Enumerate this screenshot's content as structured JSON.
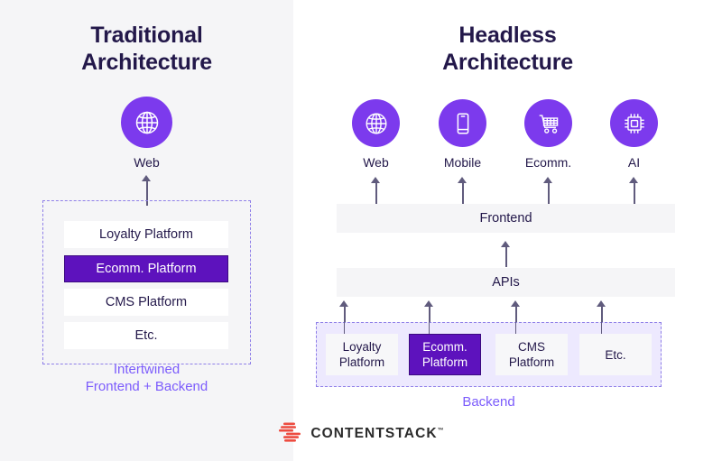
{
  "theme": {
    "page_bg": "#ffffff",
    "left_panel_bg": "#f5f5f7",
    "accent_purple": "#7c3aed",
    "deep_purple": "#5d12bd",
    "caption_purple": "#7c5cfc",
    "dash_purple": "#8f7fe8",
    "backend_fill": "#ede9fe",
    "text_dark": "#23184a",
    "arrow_gray": "#605b7d",
    "logo_red": "#ed4c40",
    "logo_word_color": "#2b2b2b"
  },
  "left": {
    "title_line1": "Traditional",
    "title_line2": "Architecture",
    "channel": {
      "icon": "globe-icon",
      "label": "Web"
    },
    "stack": [
      {
        "label": "Loyalty Platform",
        "highlight": false
      },
      {
        "label": "Ecomm. Platform",
        "highlight": true
      },
      {
        "label": "CMS Platform",
        "highlight": false
      },
      {
        "label": "Etc.",
        "highlight": false
      }
    ],
    "caption_line1": "Intertwined",
    "caption_line2": "Frontend + Backend"
  },
  "right": {
    "title_line1": "Headless",
    "title_line2": "Architecture",
    "channels": [
      {
        "icon": "globe-icon",
        "label": "Web"
      },
      {
        "icon": "mobile-icon",
        "label": "Mobile"
      },
      {
        "icon": "shopping-cart-icon",
        "label": "Ecomm."
      },
      {
        "icon": "cpu-chip-icon",
        "label": "AI"
      }
    ],
    "layers": [
      {
        "label": "Frontend"
      },
      {
        "label": "APIs"
      }
    ],
    "backend": {
      "services": [
        {
          "label_line1": "Loyalty",
          "label_line2": "Platform",
          "highlight": false
        },
        {
          "label_line1": "Ecomm.",
          "label_line2": "Platform",
          "highlight": true
        },
        {
          "label_line1": "CMS",
          "label_line2": "Platform",
          "highlight": false
        },
        {
          "label_line1": "Etc.",
          "label_line2": "",
          "highlight": false
        }
      ],
      "caption": "Backend"
    }
  },
  "logo": {
    "mark": "contentstack-logo-mark",
    "wordmark": "CONTENTSTACK",
    "trademark": "™"
  }
}
